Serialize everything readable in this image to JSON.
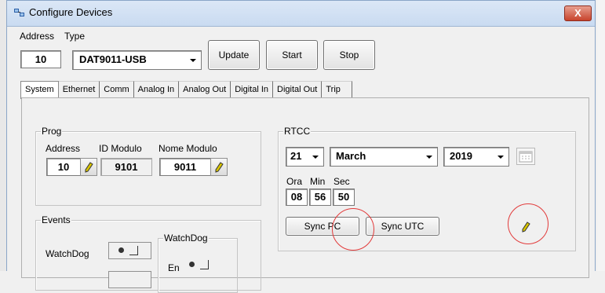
{
  "window": {
    "title": "Configure Devices",
    "close_label": "X"
  },
  "toolbar": {
    "address_label": "Address",
    "type_label": "Type",
    "address_value": "10",
    "type_value": "DAT9011-USB",
    "update_label": "Update",
    "start_label": "Start",
    "stop_label": "Stop"
  },
  "tabs": [
    {
      "label": "System"
    },
    {
      "label": "Ethernet"
    },
    {
      "label": "Comm"
    },
    {
      "label": "Analog In"
    },
    {
      "label": "Analog Out"
    },
    {
      "label": "Digital In"
    },
    {
      "label": "Digital Out"
    },
    {
      "label": "Trip"
    }
  ],
  "prog": {
    "title": "Prog",
    "address_label": "Address",
    "id_label": "ID Modulo",
    "name_label": "Nome Modulo",
    "address_value": "10",
    "id_value": "9101",
    "name_value": "9011"
  },
  "rtcc": {
    "title": "RTCC",
    "day": "21",
    "month": "March",
    "year": "2019",
    "hour_label": "Ora",
    "min_label": "Min",
    "sec_label": "Sec",
    "hour": "08",
    "min": "56",
    "sec": "50",
    "sync_pc_label": "Sync PC",
    "sync_utc_label": "Sync UTC"
  },
  "events": {
    "title": "Events",
    "watchdog_label": "WatchDog",
    "wd_group_title": "WatchDog",
    "en_label": "En"
  },
  "colors": {
    "highlight": "#e23a3a",
    "title_bar": "#c9dbf1",
    "close": "#c7432c"
  }
}
